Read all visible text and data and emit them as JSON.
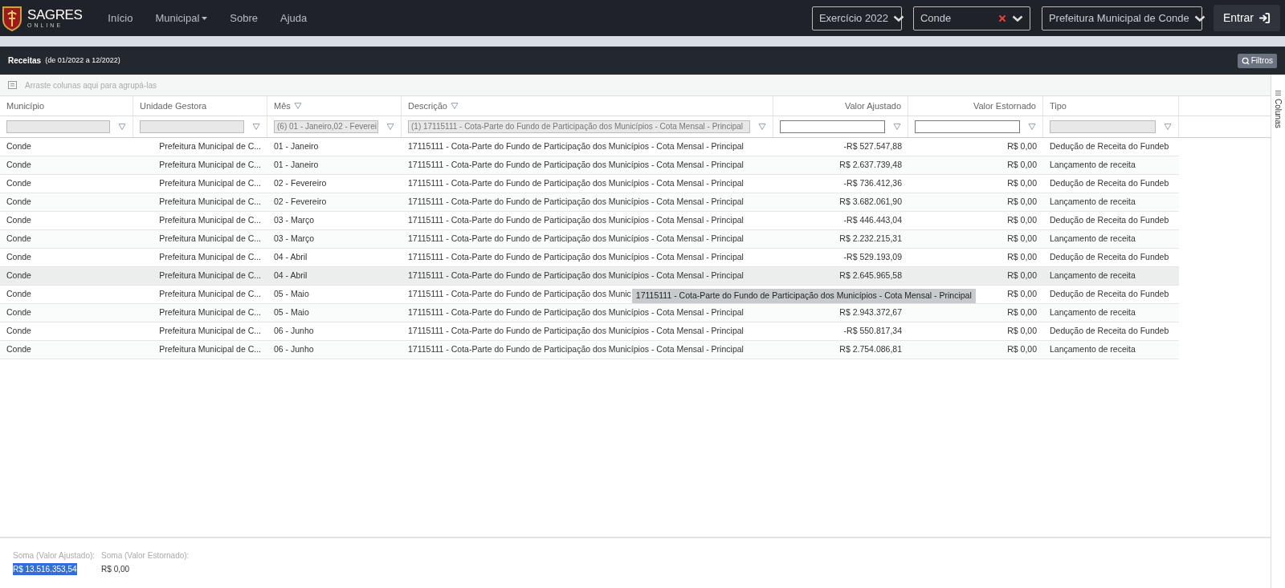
{
  "navbar": {
    "brand": "SAGRES",
    "brand_sub": "ONLINE",
    "links": [
      {
        "label": "Início",
        "dropdown": false
      },
      {
        "label": "Municipal",
        "dropdown": true
      },
      {
        "label": "Sobre",
        "dropdown": false
      },
      {
        "label": "Ajuda",
        "dropdown": false
      }
    ],
    "selects": [
      {
        "label": "Exercício",
        "value": "2022",
        "clearable": false
      },
      {
        "value": "Conde",
        "clearable": true
      },
      {
        "value": "Prefeitura Municipal de Conde",
        "clearable": false
      }
    ],
    "login_button": "Entrar"
  },
  "panel": {
    "title": "Receitas",
    "period": "(de 01/2022 a 12/2022)",
    "filters_button": "Filtros"
  },
  "grid": {
    "group_hint": "Arraste colunas aqui para agrupá-las",
    "side_panel": "Colunas",
    "columns": [
      {
        "label": "Município",
        "kind": "text",
        "filtered": false,
        "filter": {
          "disabled": true
        }
      },
      {
        "label": "Unidade Gestora",
        "kind": "text",
        "filtered": false,
        "filter": {
          "disabled": true
        }
      },
      {
        "label": "Mês",
        "kind": "text",
        "filtered": true,
        "filter": {
          "disabled": true,
          "value": "(6) 01 - Janeiro,02 - Feverei"
        }
      },
      {
        "label": "Descrição",
        "kind": "text",
        "filtered": true,
        "filter": {
          "disabled": true,
          "value": "(1) 17115111 - Cota-Parte do Fundo de Participação dos Municípios - Cota Mensal - Principal"
        }
      },
      {
        "label": "Valor Ajustado",
        "kind": "amount",
        "filtered": false,
        "filter": {
          "disabled": false
        }
      },
      {
        "label": "Valor Estornado",
        "kind": "amount",
        "filtered": false,
        "filter": {
          "disabled": false
        }
      },
      {
        "label": "Tipo",
        "kind": "text",
        "filtered": false,
        "filter": {
          "disabled": true
        }
      }
    ],
    "rows": [
      {
        "highlighted": false,
        "cells": [
          "Conde",
          "Prefeitura Municipal de C...",
          "01 - Janeiro",
          "17115111 - Cota-Parte do Fundo de Participação dos Municípios - Cota Mensal - Principal",
          "-R$ 527.547,88",
          "R$ 0,00",
          "Dedução de Receita do Fundeb"
        ]
      },
      {
        "highlighted": false,
        "cells": [
          "Conde",
          "Prefeitura Municipal de C...",
          "01 - Janeiro",
          "17115111 - Cota-Parte do Fundo de Participação dos Municípios - Cota Mensal - Principal",
          "R$ 2.637.739,48",
          "R$ 0,00",
          "Lançamento de receita"
        ]
      },
      {
        "highlighted": false,
        "cells": [
          "Conde",
          "Prefeitura Municipal de C...",
          "02 - Fevereiro",
          "17115111 - Cota-Parte do Fundo de Participação dos Municípios - Cota Mensal - Principal",
          "-R$ 736.412,36",
          "R$ 0,00",
          "Dedução de Receita do Fundeb"
        ]
      },
      {
        "highlighted": false,
        "cells": [
          "Conde",
          "Prefeitura Municipal de C...",
          "02 - Fevereiro",
          "17115111 - Cota-Parte do Fundo de Participação dos Municípios - Cota Mensal - Principal",
          "R$ 3.682.061,90",
          "R$ 0,00",
          "Lançamento de receita"
        ]
      },
      {
        "highlighted": false,
        "cells": [
          "Conde",
          "Prefeitura Municipal de C...",
          "03 - Março",
          "17115111 - Cota-Parte do Fundo de Participação dos Municípios - Cota Mensal - Principal",
          "-R$ 446.443,04",
          "R$ 0,00",
          "Dedução de Receita do Fundeb"
        ]
      },
      {
        "highlighted": false,
        "cells": [
          "Conde",
          "Prefeitura Municipal de C...",
          "03 - Março",
          "17115111 - Cota-Parte do Fundo de Participação dos Municípios - Cota Mensal - Principal",
          "R$ 2.232.215,31",
          "R$ 0,00",
          "Lançamento de receita"
        ]
      },
      {
        "highlighted": false,
        "cells": [
          "Conde",
          "Prefeitura Municipal de C...",
          "04 - Abril",
          "17115111 - Cota-Parte do Fundo de Participação dos Municípios - Cota Mensal - Principal",
          "-R$ 529.193,09",
          "R$ 0,00",
          "Dedução de Receita do Fundeb"
        ]
      },
      {
        "highlighted": true,
        "cells": [
          "Conde",
          "Prefeitura Municipal de C...",
          "04 - Abril",
          "17115111 - Cota-Parte do Fundo de Participação dos Municípios - Cota Mensal - Principal",
          "R$ 2.645.965,58",
          "R$ 0,00",
          "Lançamento de receita"
        ]
      },
      {
        "highlighted": false,
        "tooltip": "17115111 - Cota-Parte do Fundo de Participação dos Municípios - Cota Mensal - Principal",
        "cells": [
          "Conde",
          "Prefeitura Municipal de C...",
          "05 - Maio",
          "17115111 - Cota-Parte do Fundo de Participação dos Munic",
          null,
          "R$ 0,00",
          "Dedução de Receita do Fundeb"
        ]
      },
      {
        "highlighted": false,
        "cells": [
          "Conde",
          "Prefeitura Municipal de C...",
          "05 - Maio",
          "17115111 - Cota-Parte do Fundo de Participação dos Municípios - Cota Mensal - Principal",
          "R$ 2.943.372,67",
          "R$ 0,00",
          "Lançamento de receita"
        ]
      },
      {
        "highlighted": false,
        "cells": [
          "Conde",
          "Prefeitura Municipal de C...",
          "06 - Junho",
          "17115111 - Cota-Parte do Fundo de Participação dos Municípios - Cota Mensal - Principal",
          "-R$ 550.817,34",
          "R$ 0,00",
          "Dedução de Receita do Fundeb"
        ]
      },
      {
        "highlighted": false,
        "cells": [
          "Conde",
          "Prefeitura Municipal de C...",
          "06 - Junho",
          "17115111 - Cota-Parte do Fundo de Participação dos Municípios - Cota Mensal - Principal",
          "R$ 2.754.086,81",
          "R$ 0,00",
          "Lançamento de receita"
        ]
      }
    ],
    "totals": [
      {
        "label": "Soma (Valor Ajustado):",
        "value": "R$ 13.516.353,54",
        "highlighted": true
      },
      {
        "label": "Soma (Valor Estornado):",
        "value": "R$ 0,00",
        "highlighted": false
      }
    ]
  }
}
